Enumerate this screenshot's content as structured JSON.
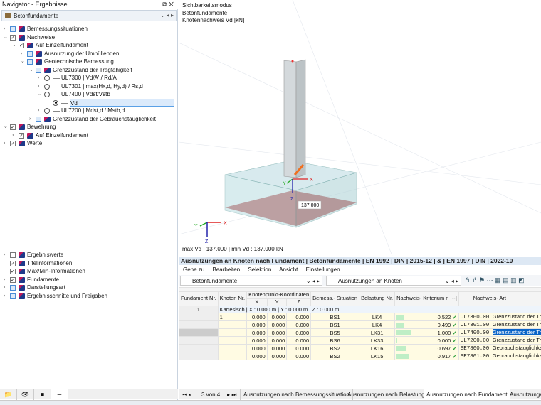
{
  "navigator": {
    "title": "Navigator - Ergebnisse",
    "combo": "Betonfundamente",
    "tree": [
      {
        "label": "Bemessungssituationen",
        "level": 0,
        "chev": ">",
        "check": "blue"
      },
      {
        "label": "Nachweise",
        "level": 0,
        "chev": "v",
        "check": "on"
      },
      {
        "label": "Auf Einzelfundament",
        "level": 1,
        "chev": "v",
        "check": "on"
      },
      {
        "label": "Ausnutzung der Umhüllenden",
        "level": 2,
        "chev": ">",
        "check": "blue"
      },
      {
        "label": "Geotechnische Bemessung",
        "level": 2,
        "chev": "v",
        "check": "blue"
      },
      {
        "label": "Grenzzustand der Tragfähigkeit",
        "level": 3,
        "chev": "v",
        "check": "blue"
      },
      {
        "label": "UL7300 | Vd/A' / Rd/A'",
        "level": 4,
        "chev": ">",
        "radio": "off"
      },
      {
        "label": "UL7301 | max(Hx,d, Hy,d) / Rs,d",
        "level": 4,
        "chev": ">",
        "radio": "off"
      },
      {
        "label": "UL7400 | Vdst/Vstb",
        "level": 4,
        "chev": "v",
        "radio": "off"
      },
      {
        "label": "Vd",
        "level": 5,
        "chev": "",
        "radio": "on",
        "selected": true
      },
      {
        "label": "UL7200 | Mdst,d / Mstb,d",
        "level": 4,
        "chev": ">",
        "radio": "off"
      },
      {
        "label": "Grenzzustand der Gebrauchstauglichkeit",
        "level": 3,
        "chev": ">",
        "check": "blue"
      },
      {
        "label": "Bewehrung",
        "level": 0,
        "chev": "v",
        "check": "on"
      },
      {
        "label": "Auf Einzelfundament",
        "level": 1,
        "chev": ">",
        "check": "on"
      },
      {
        "label": "Werte",
        "level": 0,
        "chev": ">",
        "check": "on"
      }
    ],
    "tree2": [
      {
        "label": "Ergebniswerte",
        "chev": ">",
        "check": "off"
      },
      {
        "label": "Titelinformationen",
        "chev": "",
        "check": "on"
      },
      {
        "label": "Max/Min-Informationen",
        "chev": "",
        "check": "on"
      },
      {
        "label": "Fundamente",
        "chev": ">",
        "check": "on"
      },
      {
        "label": "Darstellungsart",
        "chev": ">",
        "check": "blue"
      },
      {
        "label": "Ergebnisschnitte und Freigaben",
        "chev": ">",
        "check": "blue"
      }
    ]
  },
  "viewport": {
    "info": [
      "Sichtbarkeitsmodus",
      "Betonfundamente",
      "Knotennachweis Vd [kN]"
    ],
    "value_label": "137.000",
    "status": "max Vd : 137.000 | min Vd : 137.000 kN",
    "axes": {
      "x": "X",
      "y": "Y",
      "z": "Z"
    }
  },
  "table": {
    "title": "Ausnutzungen an Knoten nach Fundament | Betonfundamente | EN 1992 | DIN | 2015-12 | & | EN 1997 | DIN | 2022-10",
    "menu": [
      "Gehe zu",
      "Bearbeiten",
      "Selektion",
      "Ansicht",
      "Einstellungen"
    ],
    "combo1": "Betonfundamente",
    "combo2": "Ausnutzungen an Knoten",
    "headers": {
      "fund": "Fundament Nr.",
      "knoten": "Knoten Nr.",
      "coord": "Knotenpunkt-Koordinaten",
      "x": "X",
      "y": "Y",
      "z": "Z",
      "bs": "Bemess.- Situation",
      "lk": "Belastung Nr.",
      "krit": "Nachweis- Kriterium η [--]",
      "art": "Nachweis- Art"
    },
    "group": {
      "fund": "1",
      "label": "Kartesisch | X : 0.000 m | Y : 0.000 m | Z : 0.000 m"
    },
    "rows": [
      {
        "knoten": "1",
        "x": "0.000",
        "y": "0.000",
        "z": "0.000",
        "bs": "BS1",
        "lk": "LK4",
        "eta": 0.522,
        "eta_text": "0.522",
        "code": "UL7300.00",
        "desc": "Grenzzustand der Tragfähigkeit | GEO | Grundbruch n"
      },
      {
        "knoten": "",
        "x": "0.000",
        "y": "0.000",
        "z": "0.000",
        "bs": "BS1",
        "lk": "LK4",
        "eta": 0.499,
        "eta_text": "0.499",
        "code": "UL7301.00",
        "desc": "Grenzzustand der Tragfähigkeit | GEO | Gleiten nach E"
      },
      {
        "knoten": "",
        "x": "0.000",
        "y": "0.000",
        "z": "0.000",
        "bs": "BS5",
        "lk": "LK31",
        "eta": 1.0,
        "eta_text": "1.000",
        "code": "UL7400.00",
        "desc": "Grenzzustand der Tragfähigkeit | UPL | Aufschwimmen",
        "selected": true
      },
      {
        "knoten": "",
        "x": "0.000",
        "y": "0.000",
        "z": "0.000",
        "bs": "BS6",
        "lk": "LK33",
        "eta": 0.0,
        "eta_text": "0.000",
        "code": "UL7200.00",
        "desc": "Grenzzustand der Tragfähigkeit | EQU | Lagesicherheit"
      },
      {
        "knoten": "",
        "x": "0.000",
        "y": "0.000",
        "z": "0.000",
        "bs": "BS2",
        "lk": "LK16",
        "eta": 0.697,
        "eta_text": "0.697",
        "code": "SE7800.00",
        "desc": "Gebrauchstauglichkeit | GZG | Stark exzentrische Bela"
      },
      {
        "knoten": "",
        "x": "0.000",
        "y": "0.000",
        "z": "0.000",
        "bs": "BS2",
        "lk": "LK15",
        "eta": 0.917,
        "eta_text": "0.917",
        "code": "SE7801.00",
        "desc": "Gebrauchstauglichkeit | GZG | Fundamentverdrehung"
      }
    ],
    "pager": "3 von 4",
    "tabs": [
      "Ausnutzungen nach Bemessungssituation",
      "Ausnutzungen nach Belastung",
      "Ausnutzungen nach Fundament",
      "Ausnutzunge"
    ],
    "active_tab": 2
  }
}
